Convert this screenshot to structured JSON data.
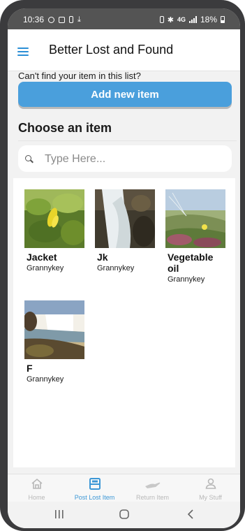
{
  "status_bar": {
    "time": "10:36",
    "network": "4G",
    "battery": "18%"
  },
  "header": {
    "menu_icon": "hamburger-icon",
    "title": "Better Lost and Found"
  },
  "prompt": {
    "text": "Can't find your item in this list?",
    "add_button": "Add new item"
  },
  "section_title": "Choose an item",
  "search": {
    "placeholder": "Type Here...",
    "value": "",
    "icon": "search-icon"
  },
  "items": [
    {
      "name": "Jacket",
      "owner": "Grannykey",
      "image": "yellow-flower-leaves-photo"
    },
    {
      "name": "Jk",
      "owner": "Grannykey",
      "image": "waterfall-rocks-photo"
    },
    {
      "name": "Vegetable oil",
      "owner": "Grannykey",
      "image": "dune-plants-photo"
    },
    {
      "name": "F",
      "owner": "Grannykey",
      "image": "waterfall-coast-photo"
    }
  ],
  "bottom_nav": [
    {
      "label": "Home",
      "icon": "home-icon",
      "active": false
    },
    {
      "label": "Post Lost Item",
      "icon": "post-item-icon",
      "active": true
    },
    {
      "label": "Return Item",
      "icon": "hand-icon",
      "active": false
    },
    {
      "label": "My Stuff",
      "icon": "user-icon",
      "active": false
    }
  ],
  "colors": {
    "accent": "#4a9fdc",
    "nav_active": "#3c97d6",
    "nav_inactive": "#b8b8b8",
    "background": "#f2f2f2"
  }
}
